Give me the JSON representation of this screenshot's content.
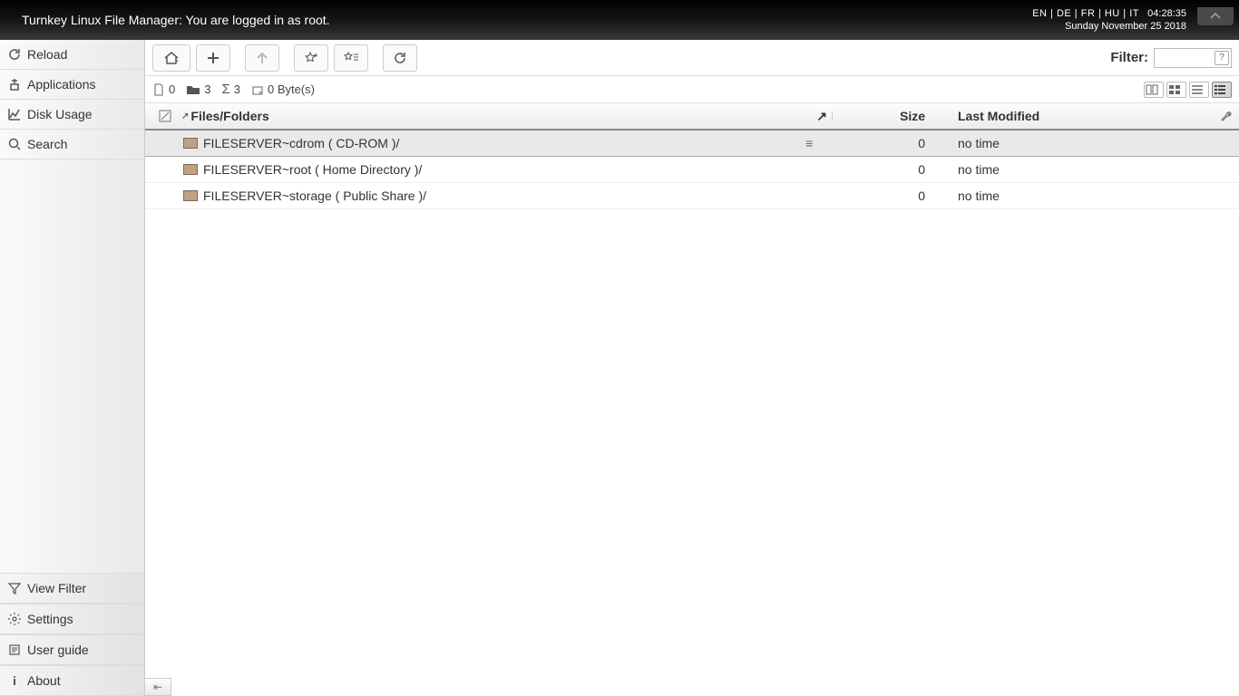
{
  "topbar": {
    "title": "Turnkey Linux File Manager: You are logged in as root.",
    "languages": "EN | DE | FR | HU | IT",
    "time": "04:28:35",
    "date": "Sunday November 25 2018"
  },
  "sidebar": {
    "top": [
      {
        "id": "reload",
        "label": "Reload"
      },
      {
        "id": "applications",
        "label": "Applications"
      },
      {
        "id": "disk-usage",
        "label": "Disk Usage"
      },
      {
        "id": "search",
        "label": "Search"
      }
    ],
    "bottom": [
      {
        "id": "view-filter",
        "label": "View Filter"
      },
      {
        "id": "settings",
        "label": "Settings"
      },
      {
        "id": "user-guide",
        "label": "User guide"
      },
      {
        "id": "about",
        "label": "About"
      }
    ]
  },
  "toolbar": {
    "filter_label": "Filter:",
    "filter_value": "",
    "filter_help": "?"
  },
  "status": {
    "files_count": "0",
    "folders_count": "3",
    "total_count": "3",
    "bytes": "0 Byte(s)"
  },
  "columns": {
    "name": "Files/Folders",
    "size": "Size",
    "modified": "Last Modified"
  },
  "rows": [
    {
      "name": "FILESERVER~cdrom ( CD-ROM )/",
      "size": "0",
      "modified": "no time",
      "selected": true
    },
    {
      "name": "FILESERVER~root ( Home Directory )/",
      "size": "0",
      "modified": "no time",
      "selected": false
    },
    {
      "name": "FILESERVER~storage ( Public Share )/",
      "size": "0",
      "modified": "no time",
      "selected": false
    }
  ]
}
